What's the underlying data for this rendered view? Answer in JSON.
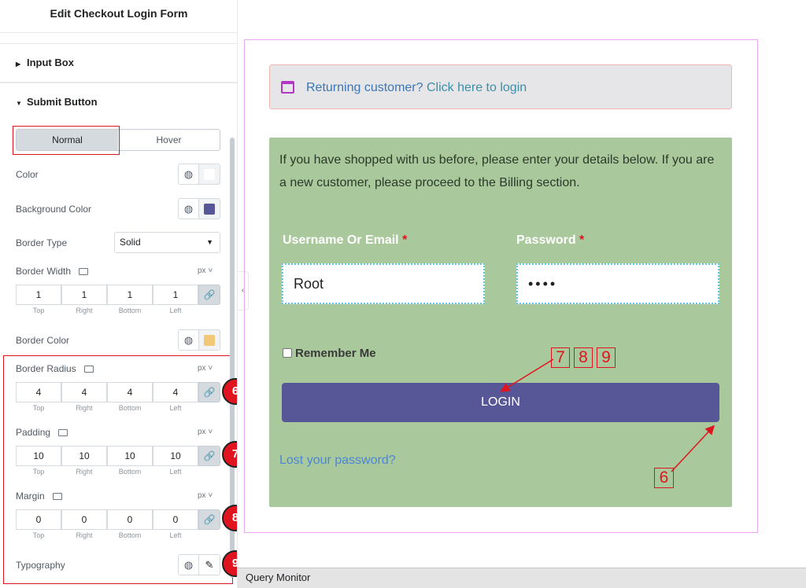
{
  "panel": {
    "title": "Edit Checkout Login Form",
    "sections": {
      "input_box": "Input Box",
      "submit_button": "Submit Button"
    },
    "tabs": {
      "normal": "Normal",
      "hover": "Hover"
    },
    "controls": {
      "color": {
        "label": "Color",
        "swatch": "#ffffff"
      },
      "background_color": {
        "label": "Background Color",
        "swatch": "#575797"
      },
      "border_type": {
        "label": "Border Type",
        "value": "Solid"
      },
      "border_width": {
        "label": "Border Width",
        "unit": "px",
        "values": [
          "1",
          "1",
          "1",
          "1"
        ]
      },
      "border_color": {
        "label": "Border Color",
        "swatch": "#f0c878"
      },
      "border_radius": {
        "label": "Border Radius",
        "unit": "px",
        "values": [
          "4",
          "4",
          "4",
          "4"
        ]
      },
      "padding": {
        "label": "Padding",
        "unit": "px",
        "values": [
          "10",
          "10",
          "10",
          "10"
        ]
      },
      "margin": {
        "label": "Margin",
        "unit": "px",
        "values": [
          "0",
          "0",
          "0",
          "0"
        ]
      },
      "typography": {
        "label": "Typography"
      }
    },
    "dim_labels": [
      "Top",
      "Right",
      "Bottom",
      "Left"
    ],
    "badges": [
      "6",
      "7",
      "8",
      "9"
    ]
  },
  "preview": {
    "notice": {
      "text": "Returning customer?",
      "link": "Click here to login"
    },
    "intro": "If you have shopped with us before, please enter your details below. If you are a new customer, please proceed to the Billing section.",
    "username_label": "Username Or Email",
    "password_label": "Password",
    "required_mark": "*",
    "username_value": "Root",
    "password_value": "••••",
    "remember_label": "Remember Me",
    "login_label": "LOGIN",
    "lost_password": "Lost your password?",
    "callouts": {
      "c7": "7",
      "c8": "8",
      "c9": "9",
      "c6": "6"
    }
  },
  "query_monitor": "Query Monitor",
  "colors": {
    "accent_red": "#e0141e",
    "button": "#575797",
    "form_bg": "#a9c89b"
  }
}
